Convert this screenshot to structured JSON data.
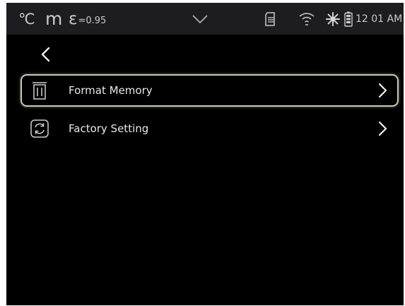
{
  "status_bar": {
    "temp_unit": "℃",
    "distance_unit": "m",
    "emissivity_symbol": "ε",
    "emissivity_value": "=0.95",
    "time": "12 01 AM",
    "icons": [
      "chevron-down-icon",
      "sd-card-icon",
      "wifi-icon",
      "brightness-icon",
      "battery-icon"
    ]
  },
  "nav": {
    "back_icon": "back-arrow-icon"
  },
  "menu": {
    "items": [
      {
        "label": "Format Memory",
        "icon": "trash-icon",
        "selected": true
      },
      {
        "label": "Factory Setting",
        "icon": "reset-icon",
        "selected": false
      }
    ]
  },
  "colors": {
    "background": "#000000",
    "status_bar": "#1d1d1f",
    "selection_border": "#c9cbb3",
    "text": "#e8e8e8"
  }
}
